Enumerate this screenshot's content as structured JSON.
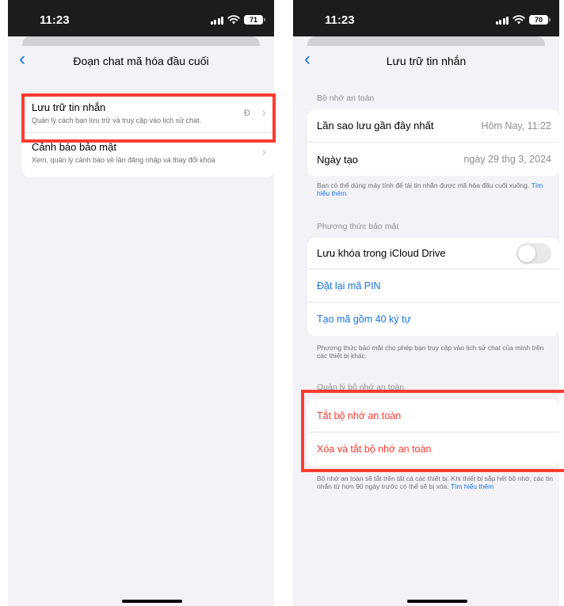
{
  "left": {
    "status": {
      "time": "11:23",
      "battery": "71"
    },
    "title": "Đoạn chat mã hóa đầu cuối",
    "items": [
      {
        "title": "Lưu trữ tin nhắn",
        "subtitle": "Quản lý cách bạn lưu trữ và truy cập vào lịch sử chat.",
        "value": "Đ"
      },
      {
        "title": "Cảnh báo bảo mật",
        "subtitle": "Xem, quản lý cảnh báo về lần đăng nhập và thay đổi khóa"
      }
    ]
  },
  "right": {
    "status": {
      "time": "11:23",
      "battery": "70"
    },
    "title": "Lưu trữ tin nhắn",
    "section1": {
      "header": "Bộ nhớ an toàn",
      "rows": [
        {
          "label": "Lần sao lưu gần đây nhất",
          "value": "Hôm Nay, 11:22"
        },
        {
          "label": "Ngày tạo",
          "value": "ngày 29 thg 3, 2024"
        }
      ],
      "footer": "Bạn có thể dùng máy tính để tải tin nhắn được mã hóa đầu cuối xuống.",
      "footer_link": "Tìm hiểu thêm"
    },
    "section2": {
      "header": "Phương thức bảo mật",
      "toggle_label": "Lưu khóa trong iCloud Drive",
      "toggle_on": false,
      "actions": [
        "Đặt lại mã PIN",
        "Tạo mã gồm 40 ký tự"
      ],
      "footer": "Phương thức bảo mật cho phép bạn truy cập vào lịch sử chat của mình trên các thiết bị khác."
    },
    "section3": {
      "header": "Quản lý bộ nhớ an toàn",
      "actions": [
        "Tắt bộ nhớ an toàn",
        "Xóa và tắt bộ nhớ an toàn"
      ],
      "footer": "Bộ nhớ an toàn sẽ tắt trên tất cả các thiết bị. Khi thiết bị sắp hết bộ nhớ, các tin nhắn từ hơn 90 ngày trước có thể sẽ bị xóa.",
      "footer_link": "Tìm hiểu thêm"
    }
  },
  "colors": {
    "accent": "#1a73e8",
    "destructive": "#ff3b30",
    "highlight": "#ff3b30"
  },
  "icons": {
    "back": "chevron-left-icon",
    "disclosure": "chevron-right-icon"
  }
}
